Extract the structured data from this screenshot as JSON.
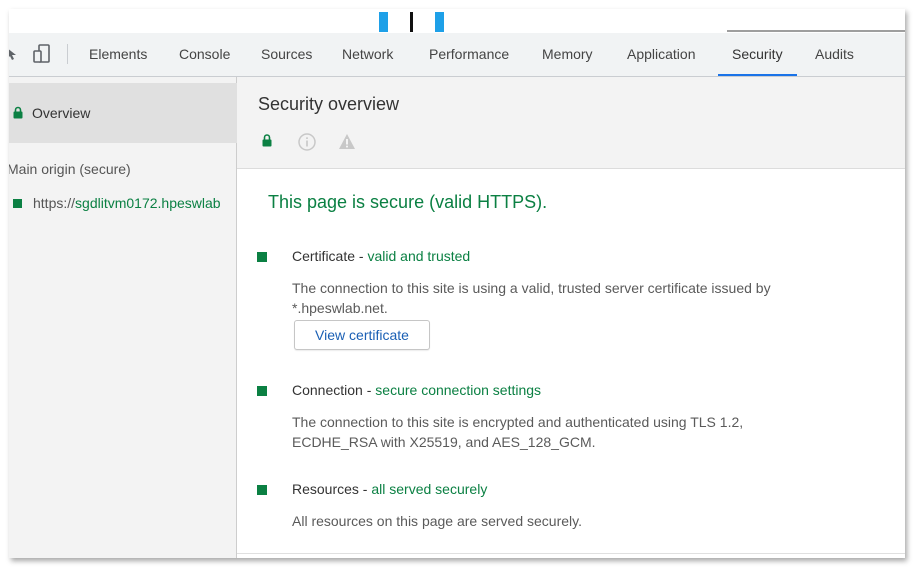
{
  "colors": {
    "secure_green": "#0b8043",
    "accent_blue": "#1a73e8",
    "link_blue": "#1a5fb4",
    "top_blue": "#1ea0e8"
  },
  "tabs": [
    {
      "label": "Elements"
    },
    {
      "label": "Console"
    },
    {
      "label": "Sources"
    },
    {
      "label": "Network"
    },
    {
      "label": "Performance"
    },
    {
      "label": "Memory"
    },
    {
      "label": "Application"
    },
    {
      "label": "Security",
      "active": true
    },
    {
      "label": "Audits"
    }
  ],
  "toolbar_icons": [
    "inspect-element-icon",
    "device-toolbar-icon"
  ],
  "sidebar": {
    "overview_label": "Overview",
    "main_origin_label": "Main origin (secure)",
    "origin_scheme": "https://",
    "origin_host": "sgdlitvm0172.hpeswlab"
  },
  "main": {
    "title": "Security overview",
    "header_icons": [
      "lock-icon",
      "info-icon",
      "warning-icon"
    ],
    "summary": "This page is secure (valid HTTPS).",
    "sections": [
      {
        "title": "Certificate",
        "separator": " - ",
        "summary": "valid and trusted",
        "description": "The connection to this site is using a valid, trusted server certificate issued by *.hpeswlab.net.",
        "button": "View certificate"
      },
      {
        "title": "Connection",
        "separator": " - ",
        "summary": "secure connection settings",
        "description": "The connection to this site is encrypted and authenticated using TLS 1.2, ECDHE_RSA with X25519, and AES_128_GCM."
      },
      {
        "title": "Resources",
        "separator": " - ",
        "summary": "all served securely",
        "description": "All resources on this page are served securely."
      }
    ]
  }
}
